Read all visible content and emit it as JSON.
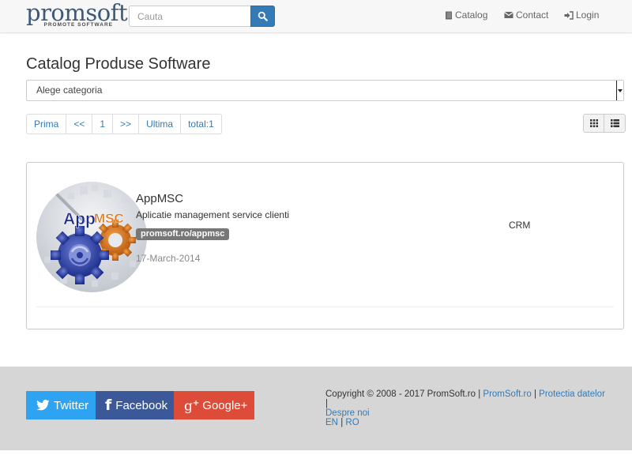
{
  "header": {
    "brand_name": "promsoft",
    "brand_tagline": "PROMOTE SOFTWARE",
    "search_placeholder": "Cauta",
    "nav": {
      "catalog": "Catalog",
      "contact": "Contact",
      "login": "Login"
    }
  },
  "main": {
    "title": "Catalog Produse Software",
    "category_select": "Alege categoria",
    "pagination": [
      "Prima",
      "<<",
      "1",
      ">>",
      "Ultima",
      "total:1"
    ]
  },
  "product": {
    "name": "AppMSC",
    "description": "Aplicatie management service clienti",
    "link": "promsoft.ro/appmsc",
    "date": "17-March-2014",
    "category": "CRM",
    "image_text_app": "App",
    "image_text_msc": "MSC"
  },
  "footer": {
    "twitter": "Twitter",
    "facebook": "Facebook",
    "google": "Google+",
    "copyright": "Copyright © 2008 - 2017 PromSoft.ro |",
    "link_promsoft": "PromSoft.ro",
    "sep1": "|",
    "link_privacy": "Protectia datelor",
    "sep2": "|",
    "link_about": "Despre noi",
    "lang_en": "EN",
    "sep3": "|",
    "lang_ro": "RO"
  },
  "colors": {
    "primary": "#337ab7",
    "twitter": "#2ea3f2",
    "facebook": "#3b5998",
    "google": "#dd4b39",
    "footer_bg": "#d6d6d6"
  }
}
